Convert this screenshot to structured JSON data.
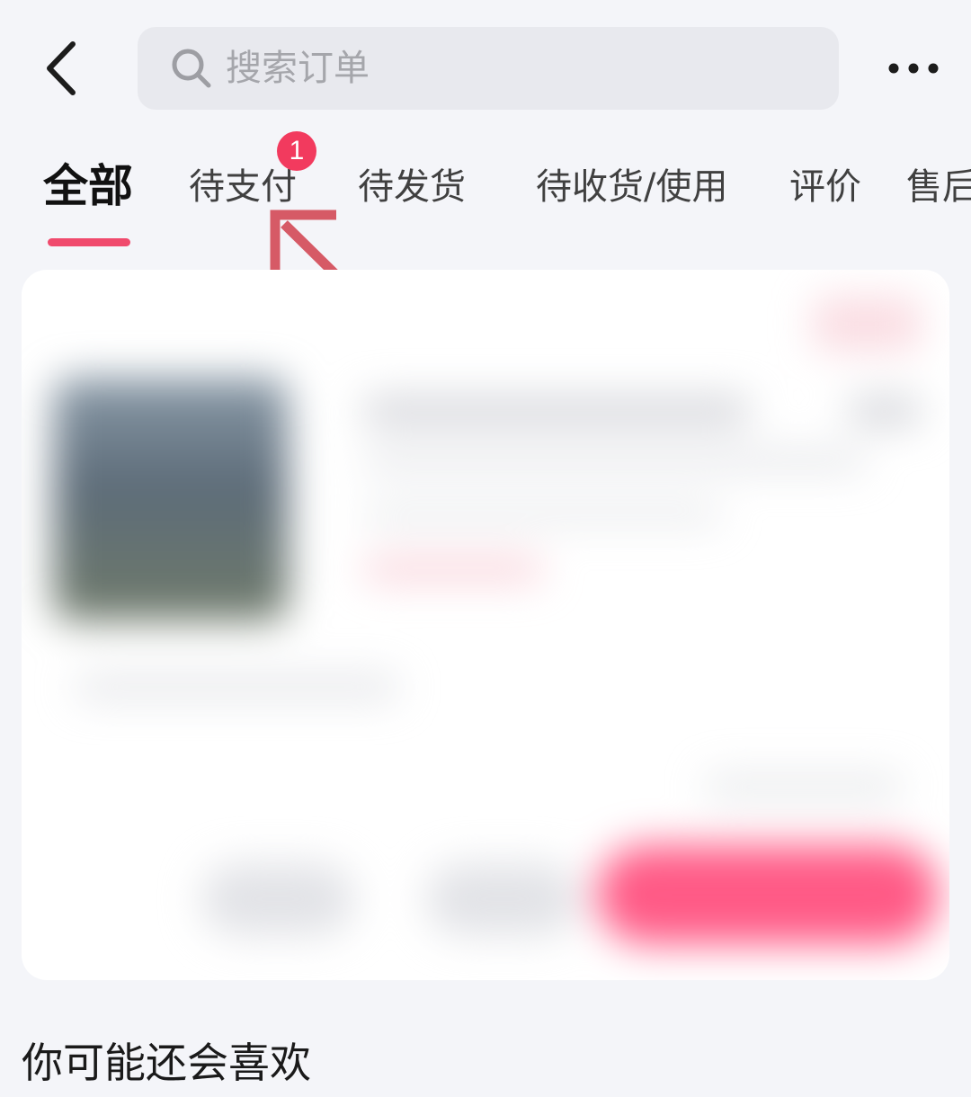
{
  "header": {
    "search_placeholder": "搜索订单",
    "back_icon": "chevron-left-icon",
    "search_icon": "search-icon",
    "more_icon": "more-dots-icon"
  },
  "tabs": [
    {
      "label": "全部",
      "active": true
    },
    {
      "label": "待支付",
      "active": false
    },
    {
      "label": "待发货",
      "active": false
    },
    {
      "label": "待收货/使用",
      "active": false
    },
    {
      "label": "评价",
      "active": false
    },
    {
      "label": "售后",
      "active": false
    }
  ],
  "badge": {
    "pending_payment_count": "1"
  },
  "recommend": {
    "title": "你可能还会喜欢"
  },
  "colors": {
    "accent": "#f04a6d",
    "badge": "#f23a5e",
    "arrow": "#d65a66",
    "background": "#f4f5f9",
    "search_bg": "#e8e9ee"
  }
}
